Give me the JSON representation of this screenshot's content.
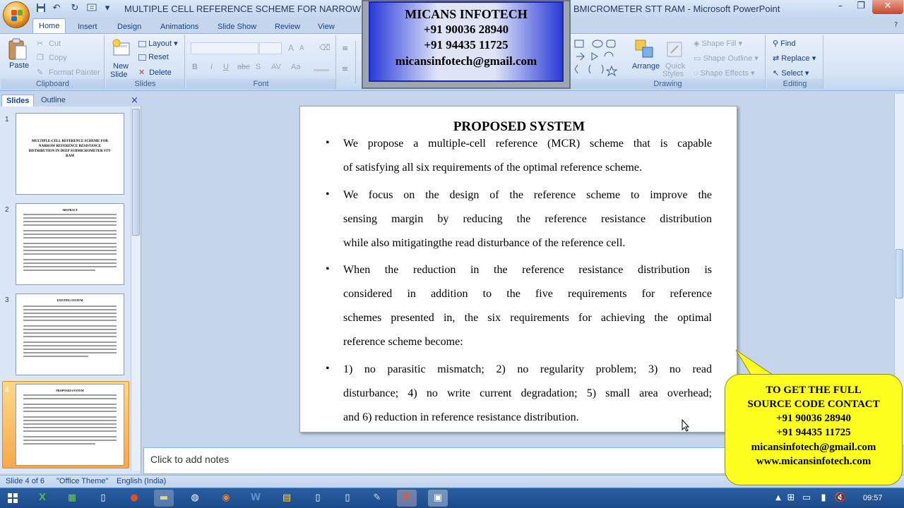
{
  "window": {
    "title": "MULTIPLE CELL REFERENCE SCHEME FOR NARROW R",
    "title_suffix": "BMICROMETER STT RAM - Microsoft PowerPoint",
    "minimize": "–",
    "restore": "❐",
    "close": "✕"
  },
  "tabs": [
    "Home",
    "Insert",
    "Design",
    "Animations",
    "Slide Show",
    "Review",
    "View"
  ],
  "ribbon": {
    "clipboard": {
      "label": "Clipboard",
      "paste": "Paste",
      "cut": "Cut",
      "copy": "Copy",
      "format_painter": "Format Painter"
    },
    "slides": {
      "label": "Slides",
      "new_slide_1": "New",
      "new_slide_2": "Slide",
      "layout": "Layout",
      "reset": "Reset",
      "delete": "Delete"
    },
    "font": {
      "label": "Font",
      "bold": "B",
      "italic": "I",
      "underline": "U",
      "strike": "abc",
      "shadow": "S",
      "spacing": "AV",
      "case": "Aa"
    },
    "drawing": {
      "label": "Drawing",
      "arrange": "Arrange",
      "quick_styles_1": "Quick",
      "quick_styles_2": "Styles",
      "shape_fill": "Shape Fill",
      "shape_outline": "Shape Outline",
      "shape_effects": "Shape Effects"
    },
    "editing": {
      "label": "Editing",
      "find": "Find",
      "replace": "Replace",
      "select": "Select"
    }
  },
  "contact_overlay": {
    "company": "MICANS INFOTECH",
    "phone1": "+91 90036 28940",
    "phone2": "+91 94435 11725",
    "email": "micansinfotech@gmail.com"
  },
  "pane": {
    "tab_slides": "Slides",
    "tab_outline": "Outline",
    "close": "×",
    "slide_numbers": [
      "1",
      "2",
      "3",
      "4"
    ],
    "thumb1_title": "MULTIPLE-CELL REFERENCE SCHEME FOR NARROW REFERENCE RESISTANCE DISTRIBUTION IN DEEP SUBMICROMETER STT-RAM",
    "thumb2_title": "ABSTRACT",
    "thumb3_title": "EXISTING SYSTEM",
    "thumb4_title": "PROPOSED SYSTEM"
  },
  "slide": {
    "title": "PROPOSED SYSTEM",
    "bullets": [
      [
        "We propose a multiple-cell reference (MCR) scheme that is capable",
        "of satisfying all six requirements of the optimal reference scheme."
      ],
      [
        "We focus on the design of the reference scheme to improve the",
        "sensing margin by reducing the reference resistance distribution",
        "while also mitigatingthe read disturbance of the reference cell."
      ],
      [
        "When the reduction in the reference resistance distribution is",
        "considered in addition to the five requirements for reference",
        "schemes presented in, the six requirements for achieving the optimal",
        "reference scheme become:"
      ],
      [
        "1) no parasitic mismatch; 2) no regularity problem; 3) no read",
        "disturbance; 4) no write current degradation; 5) small area overhead;",
        "and 6) reduction in reference resistance distribution."
      ]
    ]
  },
  "notes": {
    "placeholder": "Click to add notes"
  },
  "callout": {
    "line1": "TO GET THE FULL",
    "line2": "SOURCE CODE CONTACT",
    "line3": "+91 90036 28940",
    "line4": "+91 94435 11725",
    "line5": "micansinfotech@gmail.com",
    "line6": "www.micansinfotech.com"
  },
  "status": {
    "slide_of": "Slide 4 of 6",
    "theme": "\"Office Theme\"",
    "language": "English (India)"
  },
  "taskbar": {
    "clock": "09:57"
  },
  "colors": {
    "callout_bg": "#ffff1f",
    "overlay_blue": "#2b3bd8",
    "ribbon_text": "#15428b"
  }
}
